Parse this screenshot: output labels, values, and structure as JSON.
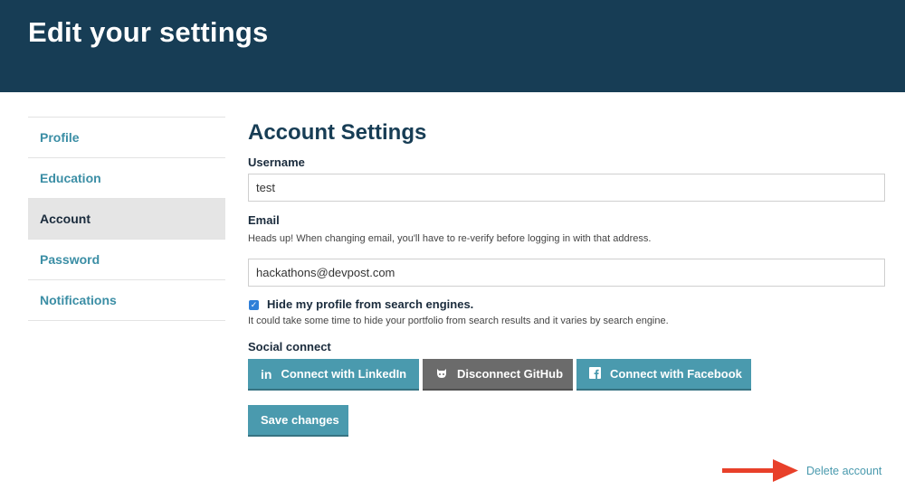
{
  "header": {
    "title": "Edit your settings"
  },
  "sidebar": {
    "items": [
      {
        "label": "Profile"
      },
      {
        "label": "Education"
      },
      {
        "label": "Account"
      },
      {
        "label": "Password"
      },
      {
        "label": "Notifications"
      }
    ],
    "active_index": 2
  },
  "main": {
    "title": "Account Settings",
    "username": {
      "label": "Username",
      "value": "test"
    },
    "email": {
      "label": "Email",
      "hint": "Heads up! When changing email, you'll have to re-verify before logging in with that address.",
      "value": "hackathons@devpost.com"
    },
    "hide_profile": {
      "checked": true,
      "label": "Hide my profile from search engines.",
      "hint": "It could take some time to hide your portfolio from search results and it varies by search engine."
    },
    "social": {
      "label": "Social connect",
      "linkedin": {
        "label": "Connect with LinkedIn",
        "icon": "linkedin-icon"
      },
      "github": {
        "label": "Disconnect GitHub",
        "icon": "github-icon"
      },
      "facebook": {
        "label": "Connect with Facebook",
        "icon": "facebook-icon"
      }
    },
    "save_label": "Save changes",
    "delete_label": "Delete account"
  },
  "colors": {
    "header_bg": "#173d55",
    "accent": "#4a9aae",
    "github_button": "#6b6b6b",
    "arrow": "#e8402a"
  }
}
